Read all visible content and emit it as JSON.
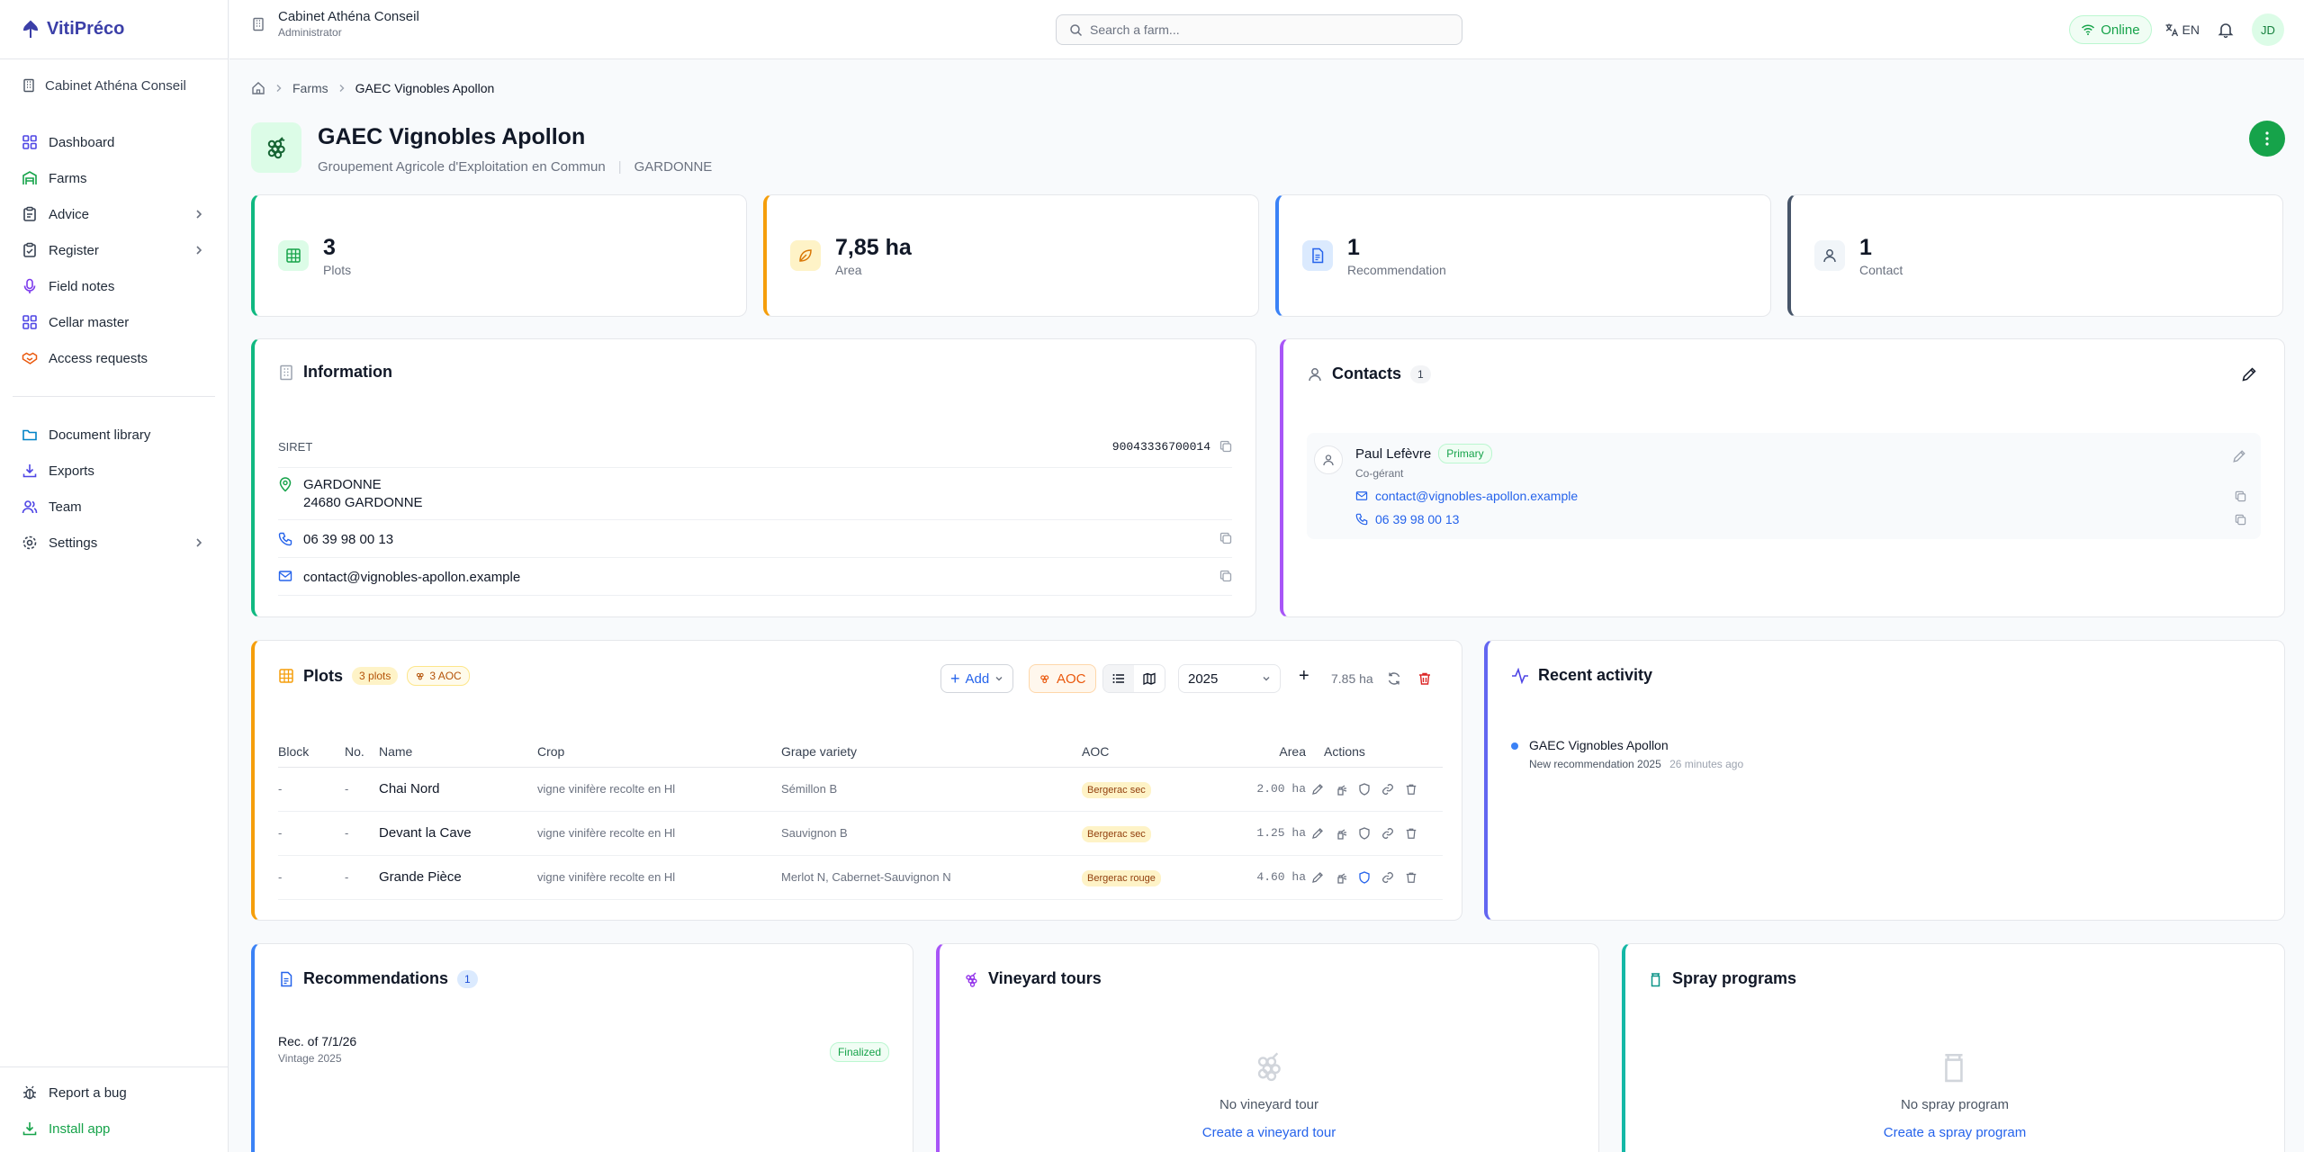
{
  "app": {
    "name": "VitiPréco"
  },
  "sidebar": {
    "org": "Cabinet Athéna Conseil",
    "items": [
      {
        "label": "Dashboard"
      },
      {
        "label": "Farms"
      },
      {
        "label": "Advice"
      },
      {
        "label": "Register"
      },
      {
        "label": "Field notes"
      },
      {
        "label": "Cellar master"
      },
      {
        "label": "Access requests"
      }
    ],
    "items2": [
      {
        "label": "Document library"
      },
      {
        "label": "Exports"
      },
      {
        "label": "Team"
      },
      {
        "label": "Settings"
      }
    ],
    "bottom": {
      "report": "Report a bug",
      "install": "Install app"
    }
  },
  "topbar": {
    "org_name": "Cabinet Athéna Conseil",
    "org_role": "Administrator",
    "search_placeholder": "Search a farm...",
    "online": "Online",
    "lang": "EN",
    "avatar": "JD"
  },
  "breadcrumb": {
    "farms": "Farms",
    "current": "GAEC Vignobles Apollon"
  },
  "farm": {
    "name": "GAEC Vignobles Apollon",
    "type": "Groupement Agricole d'Exploitation en Commun",
    "city": "GARDONNE"
  },
  "stats": [
    {
      "value": "3",
      "label": "Plots"
    },
    {
      "value": "7,85 ha",
      "label": "Area"
    },
    {
      "value": "1",
      "label": "Recommendation"
    },
    {
      "value": "1",
      "label": "Contact"
    }
  ],
  "information": {
    "title": "Information",
    "siret_label": "SIRET",
    "siret": "90043336700014",
    "address1": "GARDONNE",
    "address2": "24680 GARDONNE",
    "phone": "06 39 98 00 13",
    "email": "contact@vignobles-apollon.example"
  },
  "contacts": {
    "title": "Contacts",
    "count": "1",
    "person": {
      "name": "Paul Lefèvre",
      "badge": "Primary",
      "role": "Co-gérant",
      "email": "contact@vignobles-apollon.example",
      "phone": "06 39 98 00 13"
    }
  },
  "plots": {
    "title": "Plots",
    "badge_plots": "3 plots",
    "badge_aoc": "3 AOC",
    "add": "Add",
    "aoc_btn": "AOC",
    "year": "2025",
    "total": "7.85 ha",
    "columns": [
      "Block",
      "No.",
      "Name",
      "Crop",
      "Grape variety",
      "AOC",
      "Area",
      "Actions"
    ],
    "rows": [
      {
        "block": "-",
        "no": "-",
        "name": "Chai Nord",
        "crop": "vigne vinifère recolte en Hl",
        "variety": "Sémillon B",
        "aoc": "Bergerac sec",
        "area": "2.00 ha"
      },
      {
        "block": "-",
        "no": "-",
        "name": "Devant la Cave",
        "crop": "vigne vinifère recolte en Hl",
        "variety": "Sauvignon B",
        "aoc": "Bergerac sec",
        "area": "1.25 ha"
      },
      {
        "block": "-",
        "no": "-",
        "name": "Grande Pièce",
        "crop": "vigne vinifère recolte en Hl",
        "variety": "Merlot N, Cabernet-Sauvignon N",
        "aoc": "Bergerac rouge",
        "area": "4.60 ha"
      }
    ]
  },
  "activity": {
    "title": "Recent activity",
    "items": [
      {
        "title": "GAEC Vignobles Apollon",
        "desc": "New recommendation 2025",
        "time": "26 minutes ago"
      }
    ]
  },
  "recommendations": {
    "title": "Recommendations",
    "count": "1",
    "item": {
      "title": "Rec. of 7/1/26",
      "sub": "Vintage 2025",
      "status": "Finalized"
    }
  },
  "tours": {
    "title": "Vineyard tours",
    "empty": "No vineyard tour",
    "link": "Create a vineyard tour"
  },
  "spray": {
    "title": "Spray programs",
    "empty": "No spray program",
    "link": "Create a spray program"
  },
  "colors": {
    "accent": "#16a34a",
    "brand": "#3b3fa8",
    "info_border": "#10b981",
    "plots_border": "#f59e0b",
    "contacts_border": "#a855f7",
    "activity_border": "#6366f1",
    "rec_border": "#3b82f6"
  }
}
